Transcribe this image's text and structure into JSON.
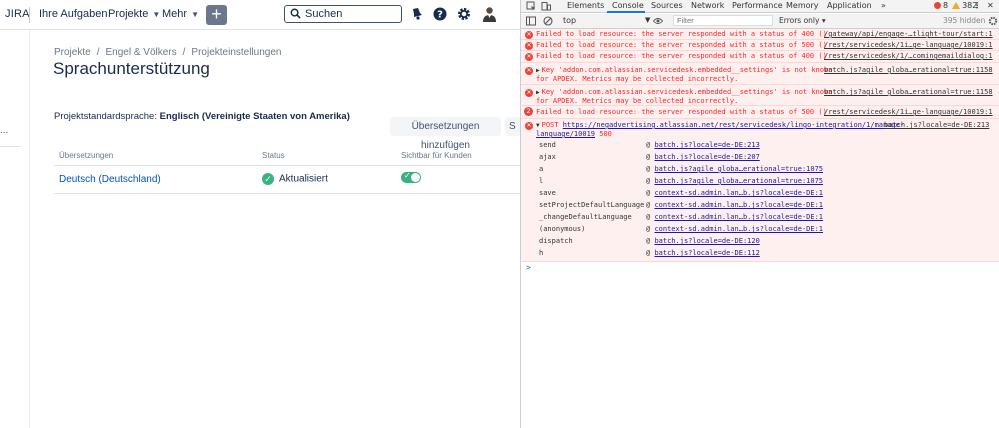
{
  "jira": {
    "logo": "JIRA",
    "nav": {
      "my_tasks": "Ihre Aufgaben",
      "projects": "Projekte",
      "more": "Mehr",
      "create": "+"
    },
    "search": {
      "placeholder": "Suchen"
    },
    "sidebar": {
      "item": "..."
    },
    "breadcrumb": [
      "Projekte",
      "Engel & Völkers",
      "Projekteinstellungen"
    ],
    "page_title": "Sprachunterstützung",
    "default_language_label": "Projektstandardsprache:",
    "default_language_value": "Englisch (Vereinigte Staaten von Amerika)",
    "add_translations_button": "Übersetzungen hinzufügen",
    "cut_button": "S",
    "table": {
      "headers": [
        "Übersetzungen",
        "Status",
        "Sichtbar für Kunden"
      ],
      "rows": [
        {
          "language": "Deutsch (Deutschland)",
          "status": "Aktualisiert",
          "visible": true
        }
      ]
    }
  },
  "devtools": {
    "tabs": [
      "Elements",
      "Console",
      "Sources",
      "Network",
      "Performance",
      "Memory",
      "Application"
    ],
    "active_tab": "Console",
    "more_tabs": "»",
    "error_count": "8",
    "warning_count": "382",
    "context": "top",
    "filter_placeholder": "Filter",
    "levels": "Errors only ▾",
    "hidden_count": "395 hidden",
    "messages": [
      {
        "text": "Failed to load resource: the server responded with a status of 400 ()",
        "source": "/gateway/api/engage-…tlight-tour/start:1"
      },
      {
        "text": "Failed to load resource: the server responded with a status of 500 ()",
        "source": "/rest/servicedesk/1i…ge-language/10019:1"
      },
      {
        "text": "Failed to load resource: the server responded with a status of 400 ()",
        "source": "/rest/servicedesk/1/…comingemaildialog:1"
      },
      {
        "line1": "Key 'addon.com.atlassian.servicedesk.embedded__settings' is not known",
        "line2": "for APDEX. Metrics may be collected incorrectly.",
        "source": "batch.js?agile_globa…erational=true:1158"
      },
      {
        "line1": "Key 'addon.com.atlassian.servicedesk.embedded__settings' is not known",
        "line2": "for APDEX. Metrics may be collected incorrectly.",
        "source": "batch.js?agile_globa…erational=true:1158"
      },
      {
        "badge": "2",
        "text": "Failed to load resource: the server responded with a status of 500 ()",
        "source": "/rest/servicedesk/1i…ge-language/10019:1"
      }
    ],
    "post_error": {
      "method": "POST",
      "url": "https://negadvertising.atlassian.net/rest/servicedesk/lingo-integration/1/manage-",
      "url2": "language/10019",
      "status": "500",
      "source": "batch.js?locale=de-DE:213"
    },
    "stack": [
      {
        "fn": "send",
        "loc": "batch.js?locale=de-DE:213"
      },
      {
        "fn": "ajax",
        "loc": "batch.js?locale=de-DE:207"
      },
      {
        "fn": "a",
        "loc": "batch.js?agile_globa…erational=true:1075"
      },
      {
        "fn": "l",
        "loc": "batch.js?agile_globa…erational=true:1075"
      },
      {
        "fn": "save",
        "loc": "context-sd.admin.lan…b.js?locale=de-DE:1"
      },
      {
        "fn": "setProjectDefaultLanguage",
        "loc": "context-sd.admin.lan…b.js?locale=de-DE:1"
      },
      {
        "fn": "_changeDefaultLanguage",
        "loc": "context-sd.admin.lan…b.js?locale=de-DE:1"
      },
      {
        "fn": "(anonymous)",
        "loc": "context-sd.admin.lan…b.js?locale=de-DE:1"
      },
      {
        "fn": "dispatch",
        "loc": "batch.js?locale=de-DE:120"
      },
      {
        "fn": "h",
        "loc": "batch.js?locale=de-DE:112"
      }
    ],
    "prompt": ">"
  }
}
